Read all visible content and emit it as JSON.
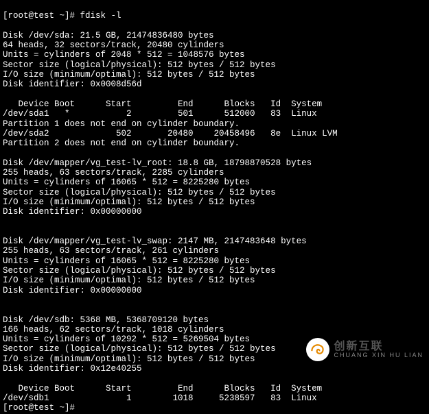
{
  "prompt1_user": "[root@test ~]#",
  "prompt1_cmd": " fdisk -l",
  "sda_header": "Disk /dev/sda: 21.5 GB, 21474836480 bytes",
  "sda_geom": "64 heads, 32 sectors/track, 20480 cylinders",
  "sda_units": "Units = cylinders of 2048 * 512 = 1048576 bytes",
  "sda_sector": "Sector size (logical/physical): 512 bytes / 512 bytes",
  "sda_io": "I/O size (minimum/optimal): 512 bytes / 512 bytes",
  "sda_id": "Disk identifier: 0x0008d56d",
  "tbl_hdr": "   Device Boot      Start         End      Blocks   Id  System",
  "sda1_row": "/dev/sda1   *           2         501      512000   83  Linux",
  "part1_warn": "Partition 1 does not end on cylinder boundary.",
  "sda2_row": "/dev/sda2             502       20480    20458496   8e  Linux LVM",
  "part2_warn": "Partition 2 does not end on cylinder boundary.",
  "root_header": "Disk /dev/mapper/vg_test-lv_root: 18.8 GB, 18798870528 bytes",
  "root_geom": "255 heads, 63 sectors/track, 2285 cylinders",
  "root_units": "Units = cylinders of 16065 * 512 = 8225280 bytes",
  "root_sector": "Sector size (logical/physical): 512 bytes / 512 bytes",
  "root_io": "I/O size (minimum/optimal): 512 bytes / 512 bytes",
  "root_id": "Disk identifier: 0x00000000",
  "swap_header": "Disk /dev/mapper/vg_test-lv_swap: 2147 MB, 2147483648 bytes",
  "swap_geom": "255 heads, 63 sectors/track, 261 cylinders",
  "swap_units": "Units = cylinders of 16065 * 512 = 8225280 bytes",
  "swap_sector": "Sector size (logical/physical): 512 bytes / 512 bytes",
  "swap_io": "I/O size (minimum/optimal): 512 bytes / 512 bytes",
  "swap_id": "Disk identifier: 0x00000000",
  "sdb_header": "Disk /dev/sdb: 5368 MB, 5368709120 bytes",
  "sdb_geom": "166 heads, 62 sectors/track, 1018 cylinders",
  "sdb_units": "Units = cylinders of 10292 * 512 = 5269504 bytes",
  "sdb_sector": "Sector size (logical/physical): 512 bytes / 512 bytes",
  "sdb_io": "I/O size (minimum/optimal): 512 bytes / 512 bytes",
  "sdb_id": "Disk identifier: 0x12e40255",
  "tbl_hdr2": "   Device Boot      Start         End      Blocks   Id  System",
  "sdb1_row": "/dev/sdb1               1        1018     5238597   83  Linux",
  "prompt2": "[root@test ~]#",
  "watermark_cn": "创新互联",
  "watermark_py": "CHUANG XIN HU LIAN"
}
